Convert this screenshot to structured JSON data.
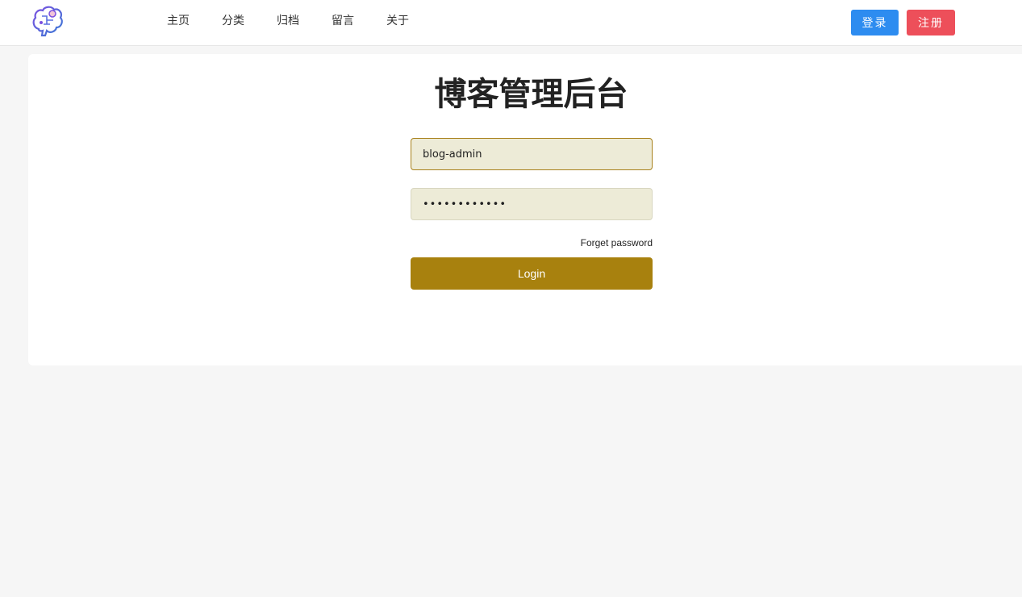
{
  "header": {
    "logo_icon": "brain-logo-icon",
    "nav": [
      {
        "label": "主页"
      },
      {
        "label": "分类"
      },
      {
        "label": "归档"
      },
      {
        "label": "留言"
      },
      {
        "label": "关于"
      }
    ],
    "login_label": "登录",
    "register_label": "注册"
  },
  "login_form": {
    "title": "博客管理后台",
    "username_value": "blog-admin",
    "password_value": "••••••••••••",
    "forget_label": "Forget password",
    "submit_label": "Login"
  },
  "colors": {
    "primary_blue": "#2d8cf0",
    "register_red": "#ed4f5a",
    "submit_gold": "#a8810e",
    "input_bg": "#edebd7"
  }
}
